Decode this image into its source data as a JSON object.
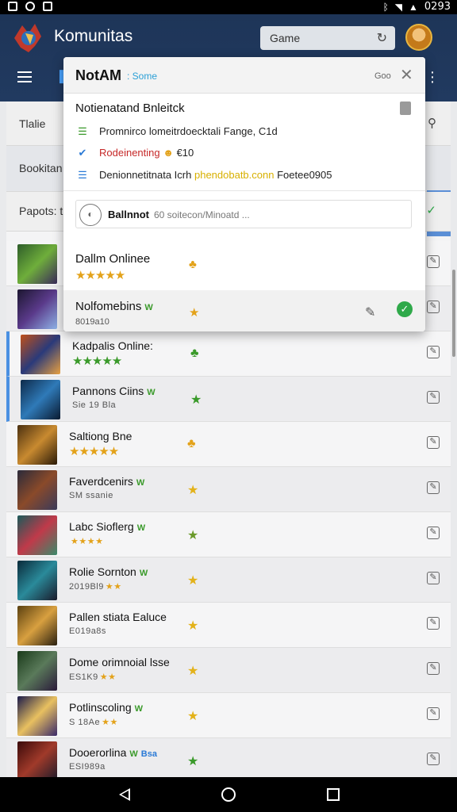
{
  "status_bar": {
    "time": "0293"
  },
  "header": {
    "title": "Komunitas",
    "search": {
      "value": "Game"
    }
  },
  "background_rows": [
    {
      "text": "Tlalie"
    },
    {
      "text": "Bookitan"
    },
    {
      "text": "Papots: t"
    }
  ],
  "games": [
    {
      "name": "",
      "sub": ""
    },
    {
      "name": "",
      "sub": ""
    },
    {
      "name": "Kadpalis Online:",
      "sub": ""
    },
    {
      "name": "Pannons Ciins",
      "tag": "W",
      "sub": "Sie 19 Bla"
    },
    {
      "name": "Saltiong Bne",
      "sub": ""
    },
    {
      "name": "Faverdcenirs",
      "tag": "W",
      "sub": "SM ssanie"
    },
    {
      "name": "Labc Sioflerg",
      "tag": "W",
      "sub": ""
    },
    {
      "name": "Rolie Sornton",
      "tag": "W",
      "sub": "2019Bl9"
    },
    {
      "name": "Pallen stiata Ealuce",
      "sub": "E019a8s"
    },
    {
      "name": "Dome orimnoial lsse",
      "sub": "ES1K9"
    },
    {
      "name": "Potlinscoling",
      "tag": "W",
      "sub": "S 18Ae"
    },
    {
      "name": "Dooerorlina",
      "tag": "W",
      "tag2": "Bsa",
      "sub": "ESI989a"
    }
  ],
  "popup": {
    "title": "NotAM",
    "subtitle": ": Some",
    "close_label": "Goo",
    "section_title": "Notienatand Bnleitck",
    "items": [
      {
        "text": "Promnirco lomeitrdoecktali Fange, C1d"
      },
      {
        "text_red": "Rodeinenting",
        "text": "€10"
      },
      {
        "text": "Denionnetitnata Icrh",
        "highlight": "phendobatb.conn",
        "text_after": "Foetee0905"
      }
    ],
    "input": {
      "value": "Ballnnot",
      "placeholder": "60 soitecon/Minoatd ..."
    },
    "rows": [
      {
        "name": "Dallm Onlinee",
        "sub": ""
      },
      {
        "name": "Nolfomebins",
        "tag": "W",
        "sub": "8019a10"
      }
    ]
  },
  "colors": {
    "header_bg": "#1e3558",
    "accent_blue": "#4a90e2",
    "star": "#e3a21a",
    "green_star": "#3a9a2a",
    "ok_green": "#2fa94a",
    "link_cyan": "#2a9fd6"
  }
}
